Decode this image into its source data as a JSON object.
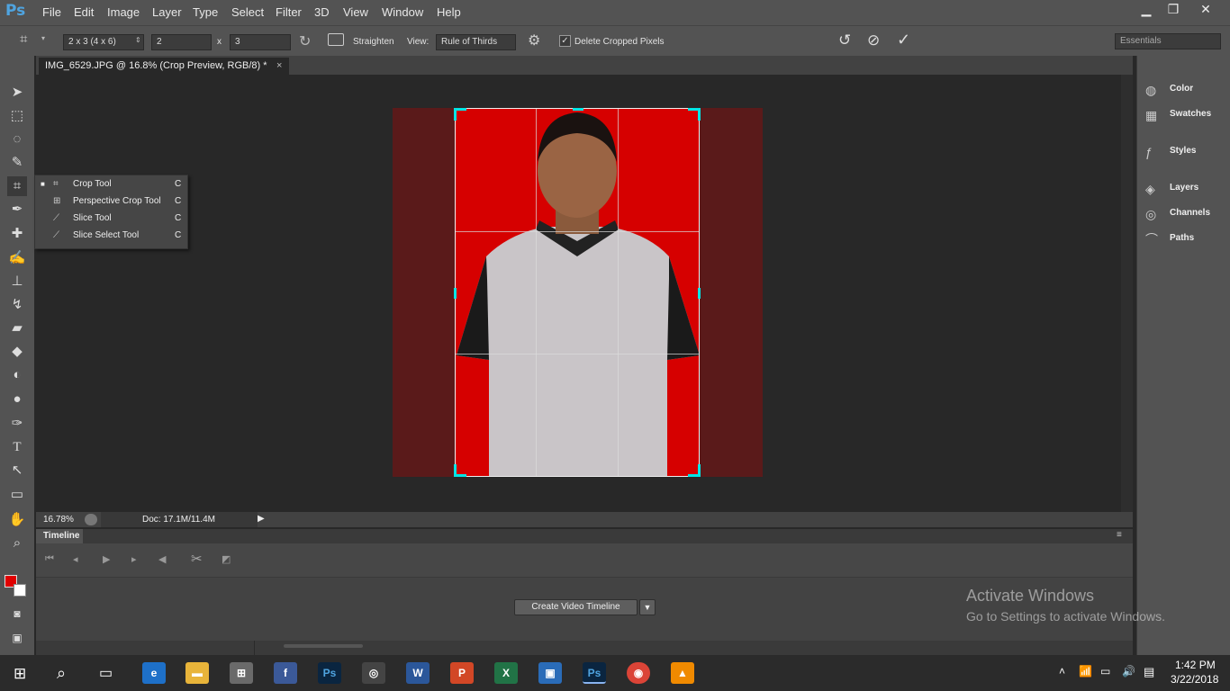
{
  "app": {
    "logo": "Ps"
  },
  "menu": [
    "File",
    "Edit",
    "Image",
    "Layer",
    "Type",
    "Select",
    "Filter",
    "3D",
    "View",
    "Window",
    "Help"
  ],
  "window_controls": {
    "minimize": "▁",
    "restore": "❐",
    "close": "✕"
  },
  "options": {
    "preset": "2 x 3 (4 x 6)",
    "width_value": "2",
    "x_sep": "x",
    "height_value": "3",
    "straighten_label": "Straighten",
    "view_label": "View:",
    "view_value": "Rule of Thirds",
    "delete_cropped_label": "Delete Cropped Pixels",
    "delete_cropped_checked": true,
    "workspace": "Essentials"
  },
  "document": {
    "tab_title": "IMG_6529.JPG @ 16.8% (Crop Preview, RGB/8) *",
    "tab_close": "×"
  },
  "flyout": [
    {
      "label": "Crop Tool",
      "shortcut": "C",
      "active": true
    },
    {
      "label": "Perspective Crop Tool",
      "shortcut": "C",
      "active": false
    },
    {
      "label": "Slice Tool",
      "shortcut": "C",
      "active": false
    },
    {
      "label": "Slice Select Tool",
      "shortcut": "C",
      "active": false
    }
  ],
  "status": {
    "zoom": "16.78%",
    "doc": "Doc: 17.1M/11.4M"
  },
  "timeline": {
    "title": "Timeline",
    "create_button": "Create Video Timeline"
  },
  "panels": [
    {
      "label": "Color",
      "icon": "color-icon"
    },
    {
      "label": "Swatches",
      "icon": "swatches-icon"
    },
    {
      "label": "Styles",
      "icon": "styles-icon"
    },
    {
      "label": "Layers",
      "icon": "layers-icon"
    },
    {
      "label": "Channels",
      "icon": "channels-icon"
    },
    {
      "label": "Paths",
      "icon": "paths-icon"
    }
  ],
  "watermark": {
    "title": "Activate Windows",
    "subtitle": "Go to Settings to activate Windows."
  },
  "taskbar": {
    "time": "1:42 PM",
    "date": "3/22/2018"
  },
  "colors": {
    "foreground": "#e00000",
    "background": "#ffffff",
    "crop_handle": "#00e5e5",
    "accent_logo": "#4fa4e0"
  }
}
